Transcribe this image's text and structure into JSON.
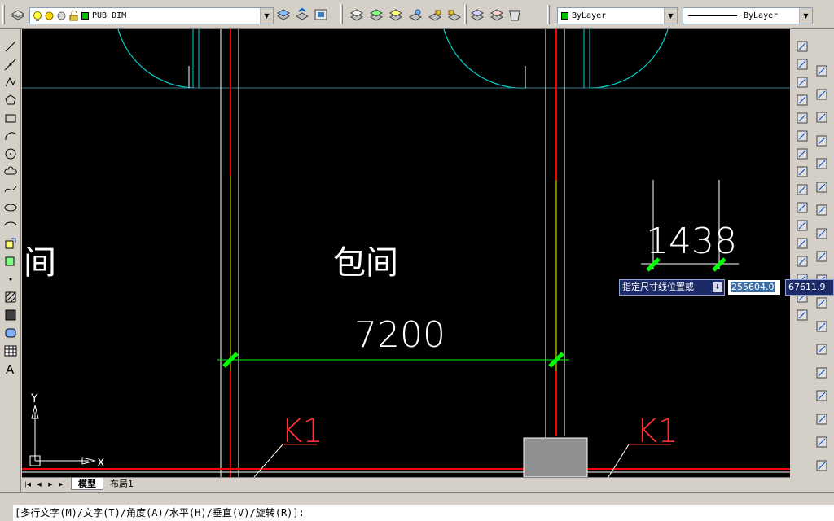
{
  "toolbar": {
    "layer_name": "PUB_DIM",
    "color_control": "ByLayer",
    "linetype_control": "ByLayer"
  },
  "colors": {
    "canvas": "#000000",
    "wall_red": "#ff0000",
    "wall_white": "#ffffff",
    "dimension_green": "#00ff00",
    "door_cyan": "#00d0d0",
    "label_red": "#ff3030",
    "dyn_bg": "#1c2a68",
    "layer_swatch": "#00c000"
  },
  "drawing": {
    "room_label_left": "间",
    "room_label_center": "包间",
    "dim_main": "7200",
    "dim_side": "1438",
    "label_k1_a": "K1",
    "label_k1_b": "K1",
    "ucs_x": "X",
    "ucs_y": "Y"
  },
  "tabs": {
    "model": "模型",
    "layout1": "布局1"
  },
  "dynamic_input": {
    "prompt": "指定尺寸线位置或",
    "x_value": "255604.0",
    "y_value": "67611.9"
  },
  "command_line": "[多行文字(M)/文字(T)/角度(A)/水平(H)/垂直(V)/旋转(R)]:",
  "icons": {
    "left_toolbar": [
      "line-icon",
      "construction-line-icon",
      "polyline-icon",
      "polygon-icon",
      "rectangle-icon",
      "arc-icon",
      "circle-icon",
      "revision-cloud-icon",
      "spline-icon",
      "ellipse-icon",
      "ellipse-arc-icon",
      "insert-block-icon",
      "make-block-icon",
      "point-icon",
      "hatch-icon",
      "gradient-icon",
      "region-icon",
      "table-icon",
      "multiline-text-icon"
    ],
    "right_toolbar": [
      "erase-icon",
      "copy-icon",
      "mirror-icon",
      "offset-icon",
      "array-icon",
      "move-icon",
      "rotate-icon",
      "scale-icon",
      "stretch-icon",
      "trim-icon",
      "extend-icon",
      "break-icon",
      "join-icon",
      "chamfer-icon",
      "fillet-icon",
      "explode-icon"
    ],
    "dim_toolbar": [
      "linear-dim-icon",
      "aligned-dim-icon",
      "arc-length-icon",
      "ordinate-icon",
      "radius-icon",
      "jogged-icon",
      "diameter-icon",
      "angular-icon",
      "quick-dim-icon",
      "baseline-icon",
      "continue-icon",
      "quick-leader-icon",
      "tolerance-icon",
      "center-mark-icon",
      "dim-edit-icon",
      "dim-text-edit-icon",
      "dim-update-icon",
      "dim-style-icon"
    ]
  }
}
